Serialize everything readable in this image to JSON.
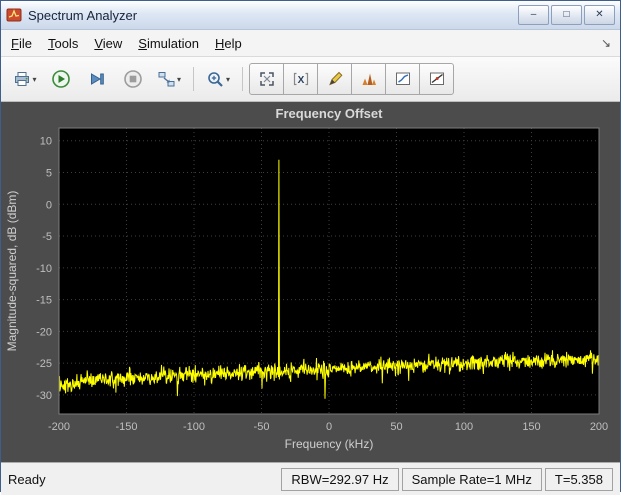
{
  "window": {
    "title": "Spectrum Analyzer",
    "controls": {
      "minimize": "–",
      "maximize": "□",
      "close": "✕"
    }
  },
  "menubar": {
    "items": [
      "File",
      "Tools",
      "View",
      "Simulation",
      "Help"
    ],
    "dock_arrow": "↘"
  },
  "toolbar": {
    "icons": [
      "printer",
      "run",
      "step-forward",
      "stop",
      "simulink-blocks",
      "zoom",
      "maximize-axes",
      "x-limits",
      "measurements",
      "peak-finder",
      "ccdf",
      "distortion"
    ],
    "caret": "▾"
  },
  "chart_data": {
    "type": "line",
    "title": "Frequency Offset",
    "xlabel": "Frequency (kHz)",
    "ylabel": "Magnitude-squared, dB (dBm)",
    "xlim": [
      -200,
      200
    ],
    "ylim": [
      -33,
      12
    ],
    "xticks": [
      -200,
      -150,
      -100,
      -50,
      0,
      50,
      100,
      150,
      200
    ],
    "yticks": [
      10,
      5,
      0,
      -5,
      -10,
      -15,
      -20,
      -25,
      -30
    ],
    "grid": true,
    "colors": {
      "figure_bg": "#4c4c4c",
      "plot_bg": "#000000",
      "grid": "#3f3f3f",
      "axis": "#7d7d7d",
      "tick": "#bfbfbf",
      "title": "#d9d9d9",
      "label": "#cfcfcf"
    },
    "series": [
      {
        "name": "spectrum",
        "color": "#ffff00",
        "noise_floor_dbm": {
          "left": -28.2,
          "right": -24.3
        },
        "noise_amplitude_db": 1.8,
        "points": 1150,
        "seed": 77,
        "spike": {
          "x_khz": -37,
          "y_dbm": 7
        },
        "notch": {
          "x_khz": -3,
          "y_dbm": -30.6
        }
      }
    ]
  },
  "statusbar": {
    "status": "Ready",
    "cells": [
      "RBW=292.97 Hz",
      "Sample Rate=1 MHz",
      "T=5.358"
    ]
  }
}
